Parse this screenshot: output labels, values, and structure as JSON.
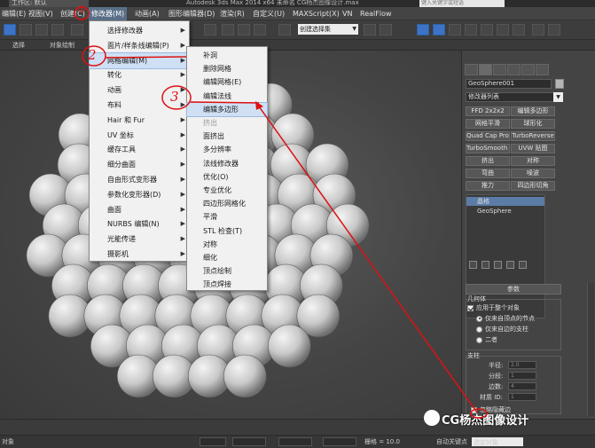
{
  "window": {
    "workspace_label": "工作区: 默认",
    "title": "Autodesk 3ds Max 2014 x64    未命名   CG杨杰图像设计.max",
    "search_placeholder": "键入关键字或短语"
  },
  "menubar": {
    "items": [
      "编辑(E)",
      "视图(V)",
      "创建(C)",
      "修改器(M)",
      "动画(A)",
      "图形编辑器(D)",
      "渲染(R)",
      "自定义(U)",
      "MAXScript(X)",
      "VN",
      "RealFlow"
    ]
  },
  "toolbar": {
    "selection_set_combo": "创建选择集",
    "view_combo": "视图"
  },
  "ribbon": {
    "select_label": "选择",
    "object_paint_label": "对象绘制"
  },
  "modifiers_menu": {
    "items": [
      {
        "label": "选择修改器",
        "has_sub": true
      },
      {
        "label": "面片/样条线编辑(P)",
        "has_sub": true
      },
      {
        "label": "网格编辑(M)",
        "has_sub": true,
        "highlighted": true
      },
      {
        "label": "转化",
        "has_sub": true
      },
      {
        "label": "动画",
        "has_sub": true
      },
      {
        "label": "布料",
        "has_sub": true
      },
      {
        "label": "Hair 和 Fur",
        "has_sub": true
      },
      {
        "label": "UV 坐标",
        "has_sub": true
      },
      {
        "label": "缓存工具",
        "has_sub": true
      },
      {
        "label": "细分曲面",
        "has_sub": true
      },
      {
        "label": "自由形式变形器",
        "has_sub": true
      },
      {
        "label": "参数化变形器(D)",
        "has_sub": true
      },
      {
        "label": "曲面",
        "has_sub": true
      },
      {
        "label": "NURBS 编辑(N)",
        "has_sub": true
      },
      {
        "label": "光能传递",
        "has_sub": true
      },
      {
        "label": "摄影机",
        "has_sub": true
      }
    ]
  },
  "mesh_edit_submenu": {
    "items": [
      {
        "label": "补洞"
      },
      {
        "label": "删除网格"
      },
      {
        "label": "编辑网格(E)"
      },
      {
        "label": "编辑法线"
      },
      {
        "label": "编辑多边形",
        "highlighted": true
      },
      {
        "label": "挤出",
        "disabled": true
      },
      {
        "label": "面挤出"
      },
      {
        "label": "多分辨率"
      },
      {
        "label": "法线修改器"
      },
      {
        "label": "优化(O)"
      },
      {
        "label": "专业优化"
      },
      {
        "label": "四边形网格化"
      },
      {
        "label": "平滑"
      },
      {
        "label": "STL 检查(T)"
      },
      {
        "label": "对称"
      },
      {
        "label": "细化"
      },
      {
        "label": "顶点绘制"
      },
      {
        "label": "顶点焊接"
      }
    ]
  },
  "annotations": {
    "step1": "①",
    "step2": "2",
    "step3": "3"
  },
  "command_panel": {
    "object_name": "GeoSphere001",
    "modifier_list": "修改器列表",
    "buttons": [
      "FFD 2x2x2",
      "编辑多边形",
      "网格平滑",
      "球形化",
      "Quad Cap Pro",
      "TurboReverse",
      "TurboSmooth Pro",
      "UVW 贴图",
      "挤出",
      "对称",
      "弯曲",
      "噪波",
      "推力",
      "四边形切角"
    ],
    "stack_items": [
      "晶格",
      "GeoSphere"
    ],
    "rollout_title": "参数",
    "geometry_label": "几何体",
    "apply_whole_label": "应用于整个对象",
    "radio_labels": [
      "仅来自顶点的节点",
      "仅来自边的支柱",
      "二者"
    ],
    "struts_label": "支柱",
    "strut_fields": [
      {
        "label": "半径:",
        "value": "2.0"
      },
      {
        "label": "分段:",
        "value": "1"
      },
      {
        "label": "边数:",
        "value": "4"
      },
      {
        "label": "材质 ID:",
        "value": "1"
      }
    ],
    "ignore_hidden_label": "忽略隐藏边"
  },
  "statusbar": {
    "selection_text": "对象",
    "grid_label": "栅格 = 10.0",
    "auto_key_label": "自动关键点",
    "selected_set": "选定对象"
  },
  "watermark": "CG杨杰图像设计",
  "colors": {
    "highlight": "#cfe0f4",
    "annotation_red": "#dd1111",
    "blue_button": "#3b74c6"
  }
}
